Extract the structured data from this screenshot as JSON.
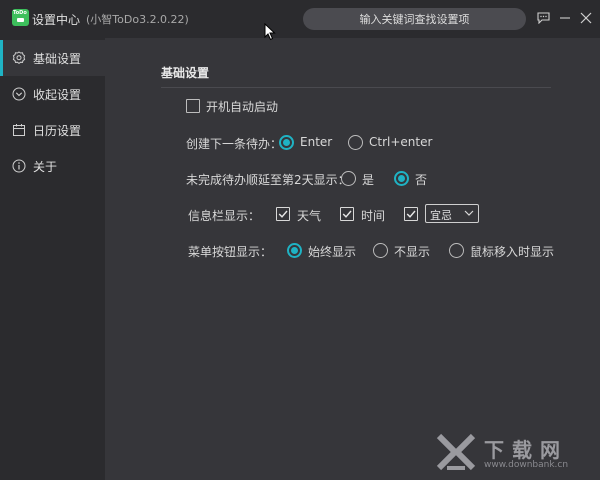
{
  "titlebar": {
    "logo_text": "ToDo",
    "app_title": "设置中心",
    "version": "(小智ToDo3.2.0.22)",
    "search_placeholder": "输入关键词查找设置项"
  },
  "sidebar": {
    "accent_color": "#1fb3c4",
    "items": [
      {
        "label": "基础设置",
        "icon": "gear-icon",
        "active": true
      },
      {
        "label": "收起设置",
        "icon": "chevron-circle-icon",
        "active": false
      },
      {
        "label": "日历设置",
        "icon": "calendar-icon",
        "active": false
      },
      {
        "label": "关于",
        "icon": "info-icon",
        "active": false
      }
    ]
  },
  "main": {
    "section_title": "基础设置",
    "startup": {
      "label": "开机自动启动",
      "checked": false
    },
    "create_next": {
      "label": "创建下一条待办：",
      "options": [
        {
          "label": "Enter",
          "selected": true
        },
        {
          "label": "Ctrl+enter",
          "selected": false
        }
      ]
    },
    "postpone": {
      "label": "未完成待办顺延至第2天显示：",
      "options": [
        {
          "label": "是",
          "selected": false
        },
        {
          "label": "否",
          "selected": true
        }
      ]
    },
    "infobar": {
      "label": "信息栏显示：",
      "items": [
        {
          "label": "天气",
          "checked": true
        },
        {
          "label": "时间",
          "checked": true
        },
        {
          "label": "",
          "checked": true
        }
      ],
      "select_value": "宜忌"
    },
    "menu_button": {
      "label": "菜单按钮显示：",
      "options": [
        {
          "label": "始终显示",
          "selected": true
        },
        {
          "label": "不显示",
          "selected": false
        },
        {
          "label": "鼠标移入时显示",
          "selected": false
        }
      ]
    }
  },
  "watermark": {
    "name": "下载网",
    "url": "www.downbank.cn"
  }
}
